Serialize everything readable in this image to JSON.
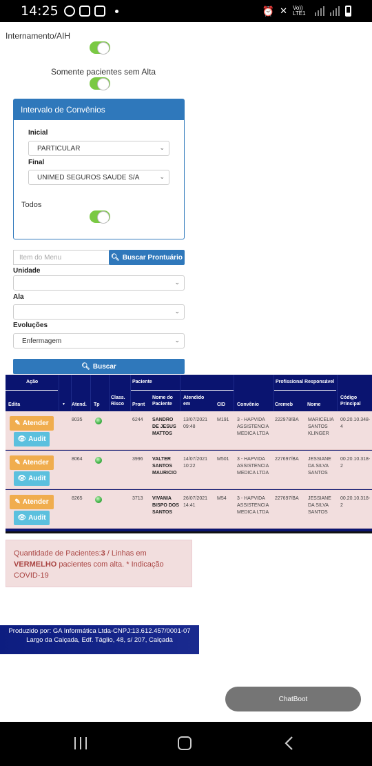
{
  "status": {
    "time": "14:25",
    "network": "Vo)) LTE1"
  },
  "filters": {
    "internamento_label": "Internamento/AIH",
    "somente_label": "Somente pacientes sem Alta"
  },
  "convenios": {
    "title": "Intervalo de Convênios",
    "inicial_label": "Inicial",
    "inicial_value": "PARTICULAR",
    "final_label": "Final",
    "final_value": "UNIMED SEGUROS SAUDE S/A",
    "todos_label": "Todos"
  },
  "search": {
    "placeholder": "Item do Menu",
    "prontuario_btn": "Buscar Prontuário",
    "unidade_label": "Unidade",
    "unidade_value": "",
    "ala_label": "Ala",
    "ala_value": "",
    "evolucoes_label": "Evoluções",
    "evolucoes_value": "Enfermagem",
    "buscar_btn": "Buscar"
  },
  "table": {
    "group_acao": "Ação",
    "group_paciente": "Paciente",
    "group_profissional": "Profissional Responsável",
    "headers": {
      "edita": "Edita",
      "sort": "▼",
      "atend": "Atend.",
      "tp": "Tp",
      "class_risco": "Class. Risco",
      "pront": "Pront",
      "nome_paciente": "Nome do Paciente",
      "atendido_em": "Atendido em",
      "cid": "CID",
      "convenio": "Convênio",
      "cremeb": "Cremeb",
      "nome": "Nome",
      "codigo_principal": "Código Principal"
    },
    "atender_label": "Atender",
    "audit_label": "Audit",
    "rows": [
      {
        "atend": "8035",
        "pront": "6244",
        "nome": "SANDRO DE JESUS MATTOS",
        "data": "13/07/2021",
        "hora": "09:48",
        "cid": "M191",
        "convenio": "3 - HAPVIDA ASSISTENCIA MEDICA LTDA",
        "cremeb": "222978/BA",
        "profissional": "MARICELIA SANTOS KLINGER",
        "codigo": "00.20.10.348-4"
      },
      {
        "atend": "8064",
        "pront": "3996",
        "nome": "VALTER SANTOS MAURICIO",
        "data": "14/07/2021",
        "hora": "10:22",
        "cid": "M501",
        "convenio": "3 - HAPVIDA ASSISTENCIA MEDICA LTDA",
        "cremeb": "227697/BA",
        "profissional": "JESSIANE DA SILVA SANTOS",
        "codigo": "00.20.10.318-2"
      },
      {
        "atend": "8265",
        "pront": "3713",
        "nome": "VIVANIA BISPO DOS SANTOS",
        "data": "26/07/2021",
        "hora": "14:41",
        "cid": "M54",
        "convenio": "3 - HAPVIDA ASSISTENCIA MEDICA LTDA",
        "cremeb": "227697/BA",
        "profissional": "JESSIANE DA SILVA SANTOS",
        "codigo": "00.20.10.318-2"
      }
    ]
  },
  "info": {
    "qty_label": "Quantidade de Pacientes:",
    "qty_value": "3",
    "text_after_qty": " / Linhas em",
    "vermelho": "VERMELHO",
    "text_rest": " pacientes com alta. * Indicação COVID-19"
  },
  "footer": {
    "line1": "Produzido por: GA Informática Ltda-CNPJ:13.612.457/0001-07",
    "line2": "Largo da Calçada, Edf. Táglio, 48, s/ 207, Calçada"
  },
  "chatbot_label": "ChatBoot",
  "colors": {
    "primary": "#2f78bb",
    "table_header": "#0a1470",
    "row_alta": "#f2dede",
    "toggle_on": "#7ac943",
    "atender": "#f0ad4e",
    "audit": "#5bc0de"
  }
}
